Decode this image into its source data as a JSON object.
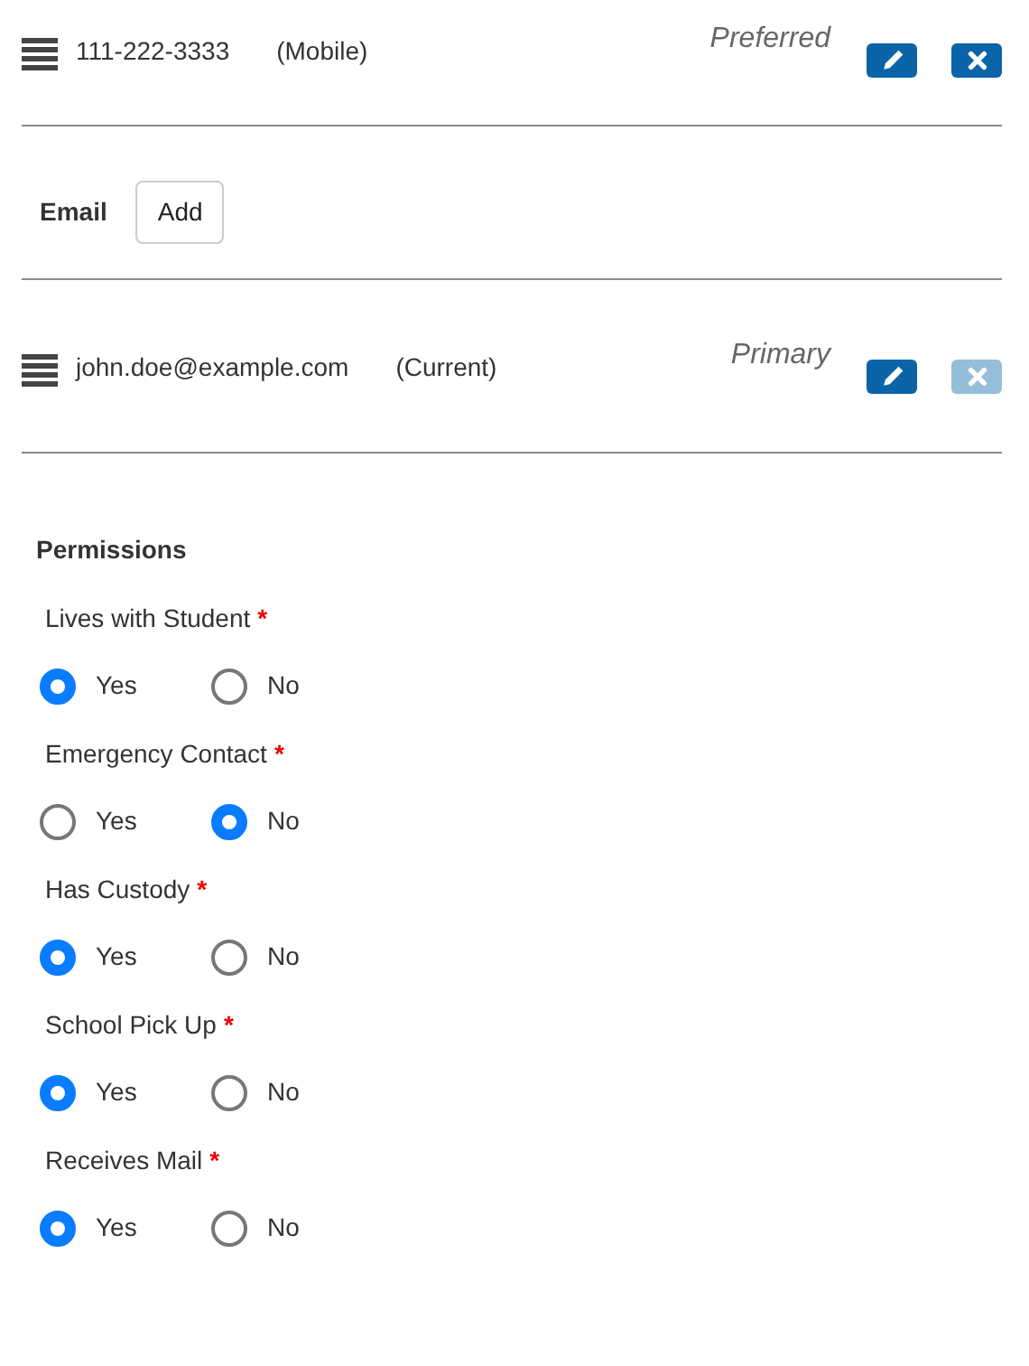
{
  "phones": [
    {
      "value": "111-222-3333",
      "type": "(Mobile)",
      "label": "Preferred",
      "delete_disabled": false
    }
  ],
  "email_section": {
    "title": "Email",
    "add_button": "Add"
  },
  "emails": [
    {
      "value": "john.doe@example.com",
      "type": "(Current)",
      "label": "Primary",
      "delete_disabled": true
    }
  ],
  "permissions": {
    "title": "Permissions",
    "questions": [
      {
        "label": "Lives with Student",
        "required_mark": "*",
        "options": [
          {
            "label": "Yes",
            "selected": true
          },
          {
            "label": "No",
            "selected": false
          }
        ]
      },
      {
        "label": "Emergency Contact",
        "required_mark": "*",
        "options": [
          {
            "label": "Yes",
            "selected": false
          },
          {
            "label": "No",
            "selected": true
          }
        ]
      },
      {
        "label": "Has Custody",
        "required_mark": "*",
        "options": [
          {
            "label": "Yes",
            "selected": true
          },
          {
            "label": "No",
            "selected": false
          }
        ]
      },
      {
        "label": "School Pick Up",
        "required_mark": "*",
        "options": [
          {
            "label": "Yes",
            "selected": true
          },
          {
            "label": "No",
            "selected": false
          }
        ]
      },
      {
        "label": "Receives Mail",
        "required_mark": "*",
        "options": [
          {
            "label": "Yes",
            "selected": true
          },
          {
            "label": "No",
            "selected": false
          }
        ]
      }
    ]
  }
}
